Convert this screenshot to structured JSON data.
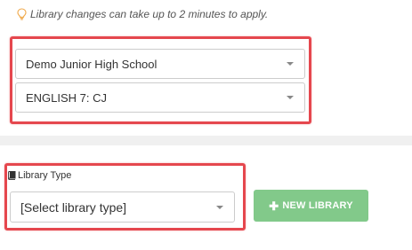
{
  "notice": {
    "icon": "lightbulb-icon",
    "text": "Library changes can take up to 2 minutes to apply."
  },
  "school_select": {
    "value": "Demo Junior High School"
  },
  "class_select": {
    "value": "ENGLISH 7: CJ"
  },
  "library_type": {
    "label": "Library Type",
    "icon": "book-icon",
    "select_value": "[Select library type]"
  },
  "new_library_button": {
    "icon": "plus-icon",
    "label": "NEW LIBRARY",
    "color": "#82c98a"
  },
  "colors": {
    "highlight": "#e5474e",
    "notice_icon": "#f0a94a"
  }
}
